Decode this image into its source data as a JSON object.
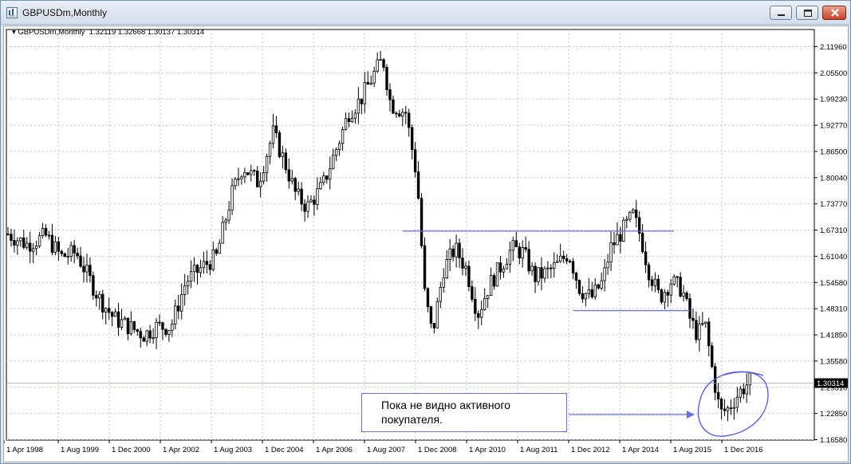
{
  "window": {
    "title": "GBPUSDm,Monthly"
  },
  "chart_info": {
    "symbol": "GBPUSDm,Monthly",
    "ohlc": "1.32119 1.32668 1.30137 1.30314"
  },
  "chart_data": {
    "type": "candlestick",
    "y_labels": [
      "2.11960",
      "2.05500",
      "1.99230",
      "1.92770",
      "1.86500",
      "1.80040",
      "1.73770",
      "1.67310",
      "1.61040",
      "1.54580",
      "1.48310",
      "1.41850",
      "1.35580",
      "1.29310",
      "1.22850",
      "1.16580"
    ],
    "x_labels": [
      "1 Apr 1998",
      "1 Aug 1999",
      "1 Dec 2000",
      "1 Apr 2002",
      "1 Aug 2003",
      "1 Dec 2004",
      "1 Apr 2006",
      "1 Aug 2007",
      "1 Dec 2008",
      "1 Apr 2010",
      "1 Aug 2011",
      "1 Dec 2012",
      "1 Apr 2014",
      "1 Aug 2015",
      "1 Dec 2016"
    ],
    "ylim": [
      1.1658,
      2.1196
    ],
    "current_price": "1.30314",
    "grid": true,
    "levels": [
      {
        "price": 1.672,
        "from": "2008-06",
        "to": "2015-08"
      },
      {
        "price": 1.479,
        "from": "2012-12",
        "to": "2016-01"
      }
    ],
    "anchors": [
      [
        1998.0,
        1.665
      ],
      [
        1998.5,
        1.64
      ],
      [
        1999.0,
        1.66
      ],
      [
        1999.4,
        1.61
      ],
      [
        1999.8,
        1.62
      ],
      [
        2000.4,
        1.51
      ],
      [
        2000.8,
        1.46
      ],
      [
        2001.2,
        1.44
      ],
      [
        2001.6,
        1.42
      ],
      [
        2001.9,
        1.44
      ],
      [
        2002.3,
        1.44
      ],
      [
        2002.7,
        1.55
      ],
      [
        2003.2,
        1.59
      ],
      [
        2003.5,
        1.61
      ],
      [
        2003.9,
        1.76
      ],
      [
        2004.2,
        1.83
      ],
      [
        2004.6,
        1.79
      ],
      [
        2005.0,
        1.91
      ],
      [
        2005.3,
        1.84
      ],
      [
        2005.6,
        1.76
      ],
      [
        2005.9,
        1.73
      ],
      [
        2006.3,
        1.78
      ],
      [
        2006.7,
        1.88
      ],
      [
        2007.0,
        1.96
      ],
      [
        2007.3,
        1.99
      ],
      [
        2007.7,
        2.06
      ],
      [
        2007.9,
        2.09
      ],
      [
        2008.1,
        1.98
      ],
      [
        2008.5,
        1.96
      ],
      [
        2008.8,
        1.8
      ],
      [
        2009.0,
        1.52
      ],
      [
        2009.2,
        1.42
      ],
      [
        2009.5,
        1.58
      ],
      [
        2009.8,
        1.63
      ],
      [
        2010.1,
        1.58
      ],
      [
        2010.4,
        1.47
      ],
      [
        2010.7,
        1.54
      ],
      [
        2010.9,
        1.57
      ],
      [
        2011.3,
        1.63
      ],
      [
        2011.6,
        1.62
      ],
      [
        2011.9,
        1.56
      ],
      [
        2012.2,
        1.57
      ],
      [
        2012.5,
        1.59
      ],
      [
        2012.8,
        1.62
      ],
      [
        2013.1,
        1.53
      ],
      [
        2013.4,
        1.51
      ],
      [
        2013.7,
        1.55
      ],
      [
        2013.9,
        1.63
      ],
      [
        2014.2,
        1.67
      ],
      [
        2014.5,
        1.71
      ],
      [
        2014.7,
        1.66
      ],
      [
        2014.9,
        1.58
      ],
      [
        2015.2,
        1.51
      ],
      [
        2015.5,
        1.55
      ],
      [
        2015.8,
        1.53
      ],
      [
        2016.0,
        1.46
      ],
      [
        2016.2,
        1.42
      ],
      [
        2016.4,
        1.45
      ],
      [
        2016.6,
        1.33
      ],
      [
        2016.8,
        1.23
      ],
      [
        2017.0,
        1.24
      ],
      [
        2017.3,
        1.28
      ],
      [
        2017.6,
        1.31
      ]
    ]
  },
  "annotation": {
    "line1": "Пока не видно активного",
    "line2": "покупателя."
  },
  "colors": {
    "candle": "#000000",
    "level_line": "#6b6fd6",
    "grid": "#b9c2cc",
    "price_tag": "#000000"
  }
}
